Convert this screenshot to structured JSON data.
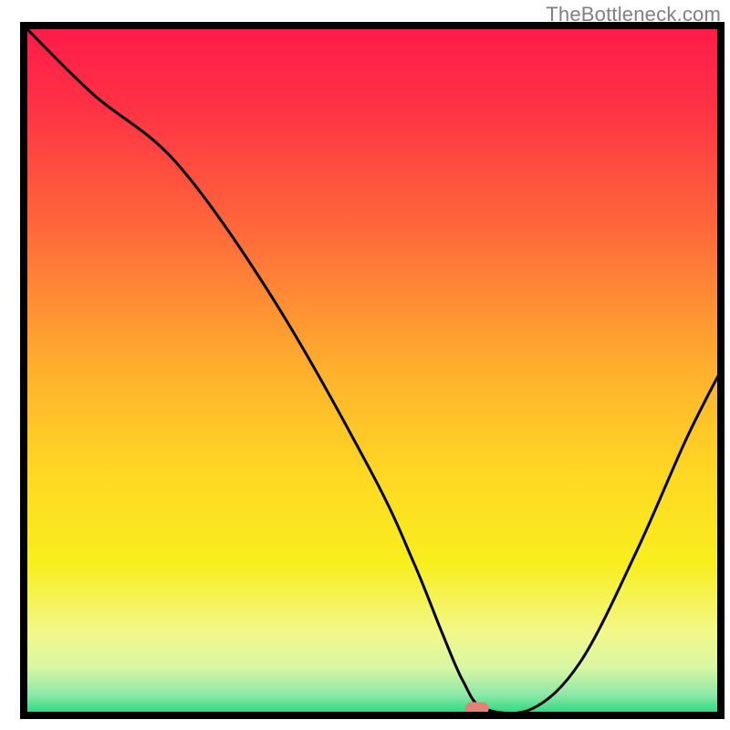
{
  "watermark": "TheBottleneck.com",
  "chart_data": {
    "type": "line",
    "title": "",
    "xlabel": "",
    "ylabel": "",
    "xlim": [
      0,
      100
    ],
    "ylim": [
      0,
      100
    ],
    "x": [
      0,
      10,
      22,
      36,
      50,
      56,
      60,
      63,
      66,
      73,
      80,
      88,
      95,
      100
    ],
    "values": [
      100,
      90,
      80,
      60,
      35,
      22,
      12,
      5,
      1,
      1,
      8,
      24,
      40,
      50
    ],
    "marker": {
      "x": 65,
      "y": 1
    },
    "gradient_stops": [
      {
        "offset": 0.0,
        "color": "#ff1b49"
      },
      {
        "offset": 0.12,
        "color": "#ff3245"
      },
      {
        "offset": 0.3,
        "color": "#ff6a3a"
      },
      {
        "offset": 0.5,
        "color": "#ffb02e"
      },
      {
        "offset": 0.65,
        "color": "#ffd823"
      },
      {
        "offset": 0.78,
        "color": "#f9ee1e"
      },
      {
        "offset": 0.88,
        "color": "#f2f78a"
      },
      {
        "offset": 0.93,
        "color": "#d9f7a3"
      },
      {
        "offset": 0.97,
        "color": "#8de8a8"
      },
      {
        "offset": 1.0,
        "color": "#1fd67c"
      }
    ],
    "marker_color": "#e48176",
    "curve_color": "#000000",
    "frame_color": "#000000"
  }
}
